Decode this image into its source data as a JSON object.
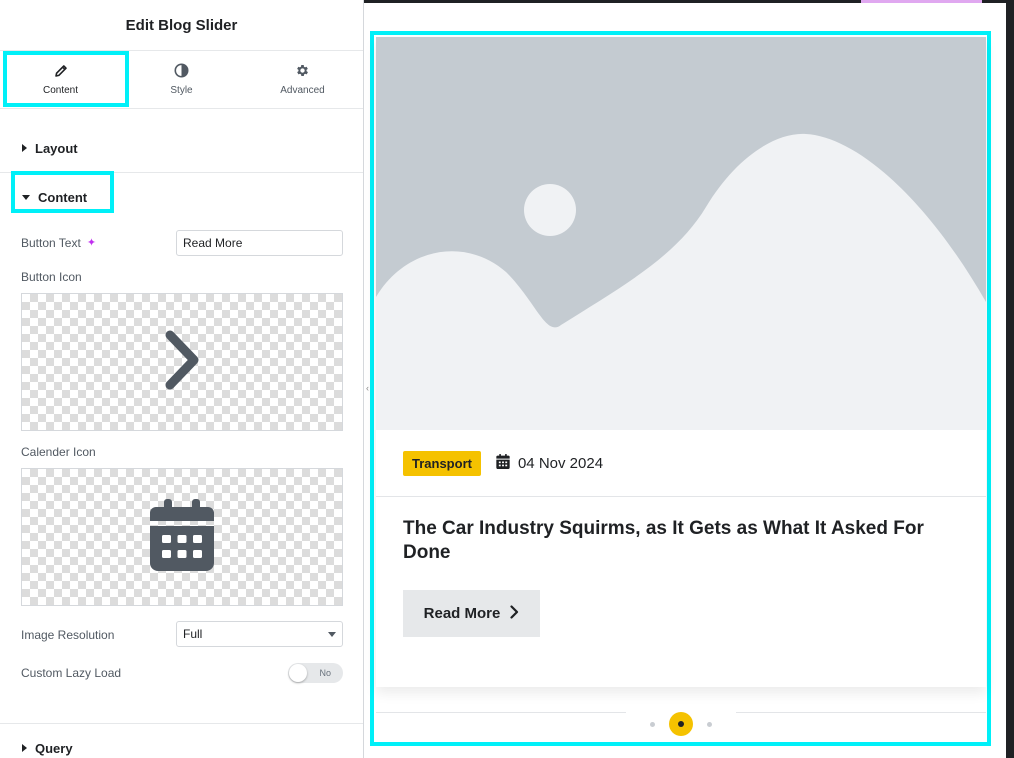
{
  "panel": {
    "title": "Edit Blog Slider",
    "tabs": [
      {
        "label": "Content",
        "icon": "pencil-icon",
        "active": true
      },
      {
        "label": "Style",
        "icon": "half-circle-icon",
        "active": false
      },
      {
        "label": "Advanced",
        "icon": "gear-icon",
        "active": false
      }
    ],
    "sections": {
      "layout": "Layout",
      "content": "Content",
      "query": "Query"
    },
    "fields": {
      "button_text_label": "Button Text",
      "button_text_value": "Read More",
      "button_icon_label": "Button Icon",
      "calendar_icon_label": "Calender Icon",
      "image_resolution_label": "Image Resolution",
      "image_resolution_value": "Full",
      "lazy_load_label": "Custom Lazy Load",
      "lazy_load_value": "No"
    }
  },
  "preview": {
    "category": "Transport",
    "date": "04 Nov 2024",
    "title": "The Car Industry Squirms, as It Gets as What It Asked For Done",
    "button": "Read More",
    "pagination": {
      "count": 3,
      "active": 2
    }
  },
  "colors": {
    "highlight": "#00f0f8",
    "accent": "#f5c200",
    "placeholder_bg": "#c4cbd1",
    "placeholder_fg": "#f0f2f4"
  }
}
